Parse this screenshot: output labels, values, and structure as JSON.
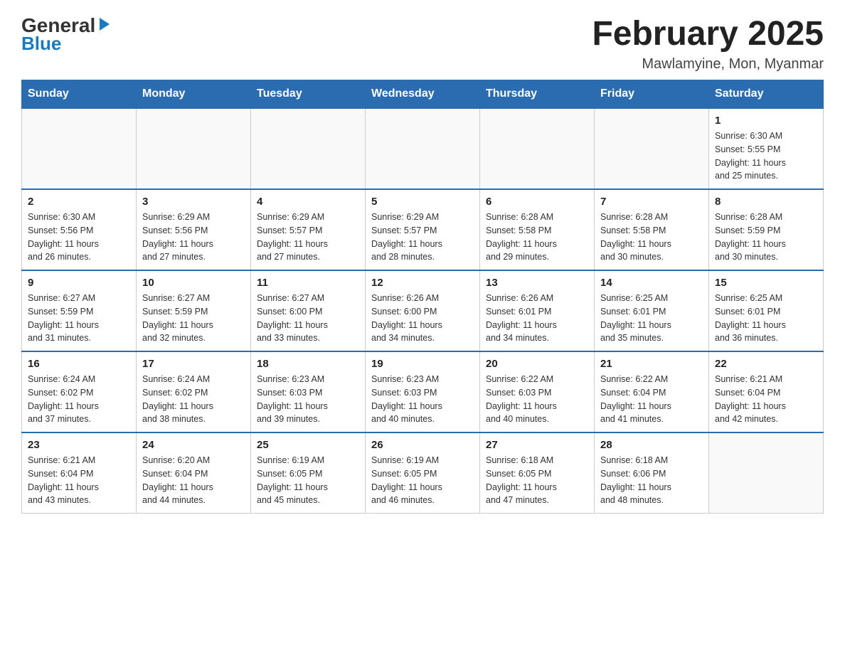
{
  "logo": {
    "general": "General",
    "blue": "Blue"
  },
  "title": "February 2025",
  "subtitle": "Mawlamyine, Mon, Myanmar",
  "days_header": [
    "Sunday",
    "Monday",
    "Tuesday",
    "Wednesday",
    "Thursday",
    "Friday",
    "Saturday"
  ],
  "weeks": [
    [
      {
        "day": "",
        "info": ""
      },
      {
        "day": "",
        "info": ""
      },
      {
        "day": "",
        "info": ""
      },
      {
        "day": "",
        "info": ""
      },
      {
        "day": "",
        "info": ""
      },
      {
        "day": "",
        "info": ""
      },
      {
        "day": "1",
        "info": "Sunrise: 6:30 AM\nSunset: 5:55 PM\nDaylight: 11 hours\nand 25 minutes."
      }
    ],
    [
      {
        "day": "2",
        "info": "Sunrise: 6:30 AM\nSunset: 5:56 PM\nDaylight: 11 hours\nand 26 minutes."
      },
      {
        "day": "3",
        "info": "Sunrise: 6:29 AM\nSunset: 5:56 PM\nDaylight: 11 hours\nand 27 minutes."
      },
      {
        "day": "4",
        "info": "Sunrise: 6:29 AM\nSunset: 5:57 PM\nDaylight: 11 hours\nand 27 minutes."
      },
      {
        "day": "5",
        "info": "Sunrise: 6:29 AM\nSunset: 5:57 PM\nDaylight: 11 hours\nand 28 minutes."
      },
      {
        "day": "6",
        "info": "Sunrise: 6:28 AM\nSunset: 5:58 PM\nDaylight: 11 hours\nand 29 minutes."
      },
      {
        "day": "7",
        "info": "Sunrise: 6:28 AM\nSunset: 5:58 PM\nDaylight: 11 hours\nand 30 minutes."
      },
      {
        "day": "8",
        "info": "Sunrise: 6:28 AM\nSunset: 5:59 PM\nDaylight: 11 hours\nand 30 minutes."
      }
    ],
    [
      {
        "day": "9",
        "info": "Sunrise: 6:27 AM\nSunset: 5:59 PM\nDaylight: 11 hours\nand 31 minutes."
      },
      {
        "day": "10",
        "info": "Sunrise: 6:27 AM\nSunset: 5:59 PM\nDaylight: 11 hours\nand 32 minutes."
      },
      {
        "day": "11",
        "info": "Sunrise: 6:27 AM\nSunset: 6:00 PM\nDaylight: 11 hours\nand 33 minutes."
      },
      {
        "day": "12",
        "info": "Sunrise: 6:26 AM\nSunset: 6:00 PM\nDaylight: 11 hours\nand 34 minutes."
      },
      {
        "day": "13",
        "info": "Sunrise: 6:26 AM\nSunset: 6:01 PM\nDaylight: 11 hours\nand 34 minutes."
      },
      {
        "day": "14",
        "info": "Sunrise: 6:25 AM\nSunset: 6:01 PM\nDaylight: 11 hours\nand 35 minutes."
      },
      {
        "day": "15",
        "info": "Sunrise: 6:25 AM\nSunset: 6:01 PM\nDaylight: 11 hours\nand 36 minutes."
      }
    ],
    [
      {
        "day": "16",
        "info": "Sunrise: 6:24 AM\nSunset: 6:02 PM\nDaylight: 11 hours\nand 37 minutes."
      },
      {
        "day": "17",
        "info": "Sunrise: 6:24 AM\nSunset: 6:02 PM\nDaylight: 11 hours\nand 38 minutes."
      },
      {
        "day": "18",
        "info": "Sunrise: 6:23 AM\nSunset: 6:03 PM\nDaylight: 11 hours\nand 39 minutes."
      },
      {
        "day": "19",
        "info": "Sunrise: 6:23 AM\nSunset: 6:03 PM\nDaylight: 11 hours\nand 40 minutes."
      },
      {
        "day": "20",
        "info": "Sunrise: 6:22 AM\nSunset: 6:03 PM\nDaylight: 11 hours\nand 40 minutes."
      },
      {
        "day": "21",
        "info": "Sunrise: 6:22 AM\nSunset: 6:04 PM\nDaylight: 11 hours\nand 41 minutes."
      },
      {
        "day": "22",
        "info": "Sunrise: 6:21 AM\nSunset: 6:04 PM\nDaylight: 11 hours\nand 42 minutes."
      }
    ],
    [
      {
        "day": "23",
        "info": "Sunrise: 6:21 AM\nSunset: 6:04 PM\nDaylight: 11 hours\nand 43 minutes."
      },
      {
        "day": "24",
        "info": "Sunrise: 6:20 AM\nSunset: 6:04 PM\nDaylight: 11 hours\nand 44 minutes."
      },
      {
        "day": "25",
        "info": "Sunrise: 6:19 AM\nSunset: 6:05 PM\nDaylight: 11 hours\nand 45 minutes."
      },
      {
        "day": "26",
        "info": "Sunrise: 6:19 AM\nSunset: 6:05 PM\nDaylight: 11 hours\nand 46 minutes."
      },
      {
        "day": "27",
        "info": "Sunrise: 6:18 AM\nSunset: 6:05 PM\nDaylight: 11 hours\nand 47 minutes."
      },
      {
        "day": "28",
        "info": "Sunrise: 6:18 AM\nSunset: 6:06 PM\nDaylight: 11 hours\nand 48 minutes."
      },
      {
        "day": "",
        "info": ""
      }
    ]
  ]
}
